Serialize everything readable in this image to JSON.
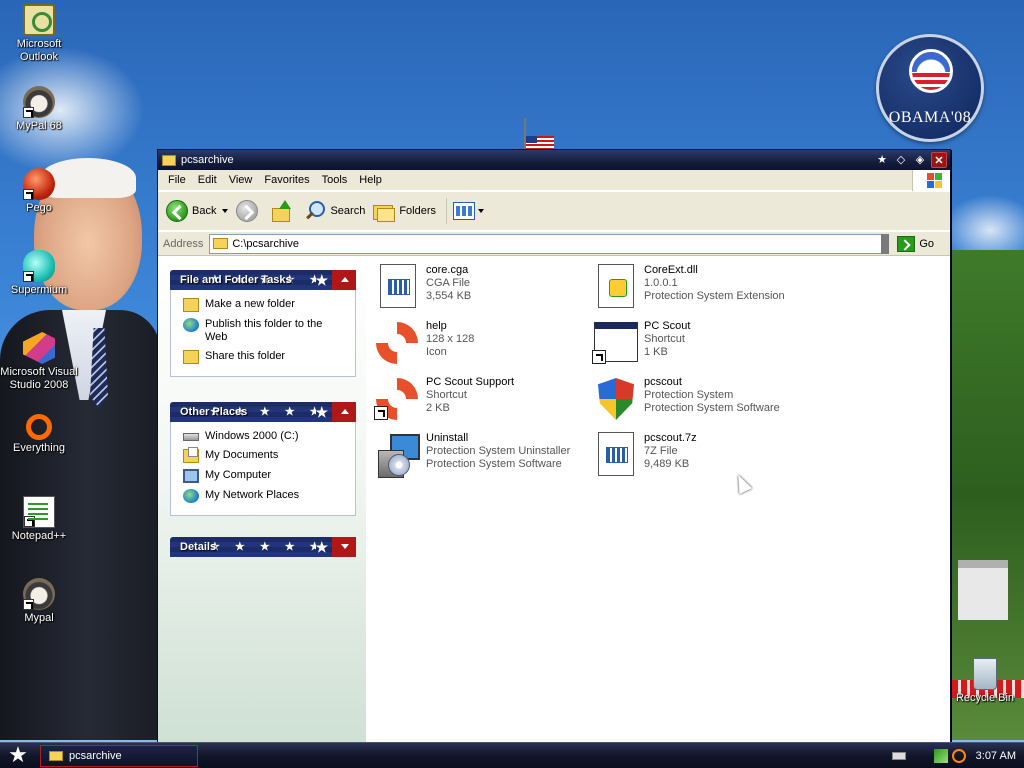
{
  "desktop": {
    "icons": [
      {
        "label": "Microsoft Outlook",
        "icon": "outlook-icon"
      },
      {
        "label": "MyPal 68",
        "icon": "mypal-icon"
      },
      {
        "label": "Pego",
        "icon": "pego-icon"
      },
      {
        "label": "Supermium",
        "icon": "supermium-icon"
      },
      {
        "label": "Microsoft Visual Studio 2008",
        "icon": "visual-studio-icon"
      },
      {
        "label": "Everything",
        "icon": "everything-icon"
      },
      {
        "label": "Notepad++",
        "icon": "notepadpp-icon"
      },
      {
        "label": "Mypal",
        "icon": "mypal-icon"
      },
      {
        "label": "Recycle Bin",
        "icon": "recycle-bin-icon"
      }
    ],
    "badge": {
      "text": "OBAMA'08"
    }
  },
  "window": {
    "title": "pcsarchive",
    "menu": [
      "File",
      "Edit",
      "View",
      "Favorites",
      "Tools",
      "Help"
    ],
    "toolbar": {
      "back_label": "Back",
      "search_label": "Search",
      "folders_label": "Folders"
    },
    "address": {
      "label": "Address",
      "value": "C:\\pcsarchive",
      "go_label": "Go"
    },
    "panels": {
      "file_tasks": {
        "title": "File and Folder Tasks",
        "items": [
          "Make a new folder",
          "Publish this folder to the Web",
          "Share this folder"
        ]
      },
      "other_places": {
        "title": "Other Places",
        "items": [
          "Windows 2000 (C:)",
          "My Documents",
          "My Computer",
          "My Network Places"
        ]
      },
      "details": {
        "title": "Details"
      }
    },
    "files": [
      {
        "name": "core.cga",
        "line2": "CGA File",
        "line3": "3,554 KB",
        "icon": "document-icon"
      },
      {
        "name": "CoreExt.dll",
        "line2": "1.0.0.1",
        "line3": "Protection System Extension",
        "icon": "dll-icon"
      },
      {
        "name": "help",
        "line2": "128 x 128",
        "line3": "Icon",
        "icon": "lifebuoy-icon"
      },
      {
        "name": "PC Scout",
        "line2": "Shortcut",
        "line3": "1 KB",
        "icon": "window-shortcut-icon"
      },
      {
        "name": "PC Scout Support",
        "line2": "Shortcut",
        "line3": "2 KB",
        "icon": "lifebuoy-shortcut-icon"
      },
      {
        "name": "pcscout",
        "line2": "Protection System",
        "line3": "Protection System Software",
        "icon": "shield-icon"
      },
      {
        "name": "Uninstall",
        "line2": "Protection System Uninstaller",
        "line3": "Protection System Software",
        "icon": "installer-icon"
      },
      {
        "name": "pcscout.7z",
        "line2": "7Z File",
        "line3": "9,489 KB",
        "icon": "document-icon"
      }
    ]
  },
  "taskbar": {
    "task_label": "pcsarchive",
    "clock": "3:07 AM"
  },
  "colors": {
    "titlebar": "#151d3c",
    "panel_header": "#1b2c66",
    "accent_red": "#b01818"
  }
}
